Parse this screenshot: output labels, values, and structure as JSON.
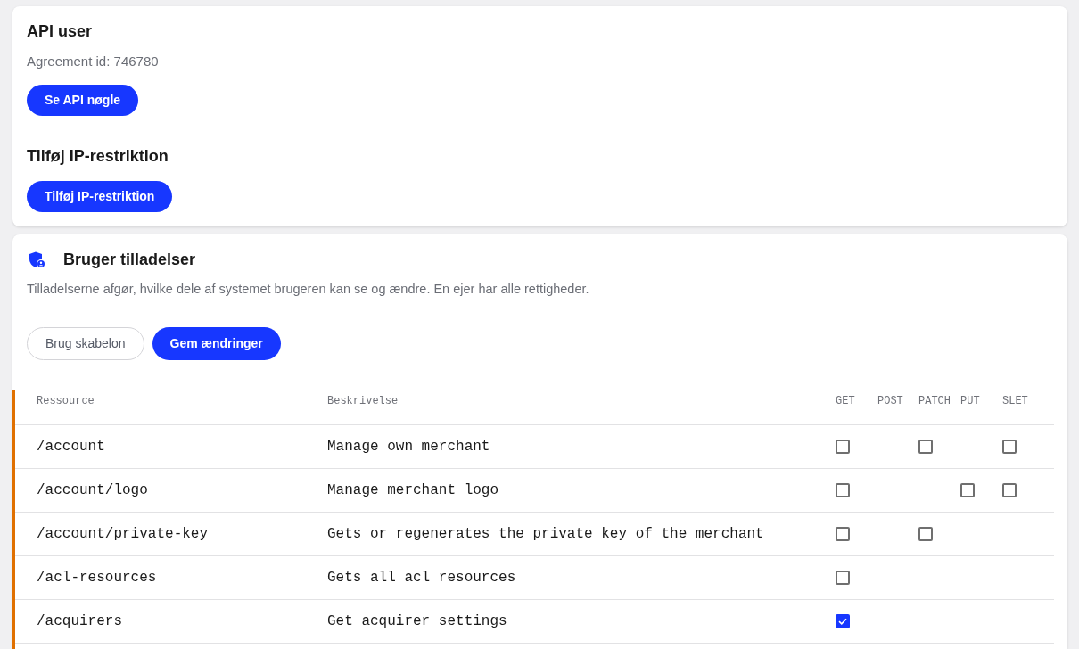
{
  "api_user": {
    "title": "API user",
    "agreement": "Agreement id: 746780",
    "button": "Se API nøgle"
  },
  "ip_restriction": {
    "title": "Tilføj IP-restriktion",
    "button": "Tilføj IP-restriktion"
  },
  "permissions": {
    "title": "Bruger tilladelser",
    "description": "Tilladelserne afgør, hvilke dele af systemet brugeren kan se og ændre. En ejer har alle rettigheder.",
    "buttons": [
      {
        "label": "Brug skabelon",
        "kind": "outline"
      },
      {
        "label": "Gem ændringer",
        "kind": "primary"
      }
    ],
    "table": {
      "columns": [
        "Ressource",
        "Beskrivelse",
        "GET",
        "POST",
        "PATCH",
        "PUT",
        "SLET"
      ],
      "rows": [
        {
          "resource": "/account",
          "description": "Manage own merchant",
          "methods": [
            {
              "kind": "checkbox",
              "checked": false
            },
            {
              "kind": "none"
            },
            {
              "kind": "checkbox",
              "checked": false
            },
            {
              "kind": "none"
            },
            {
              "kind": "checkbox",
              "checked": false
            }
          ]
        },
        {
          "resource": "/account/logo",
          "description": "Manage merchant logo",
          "methods": [
            {
              "kind": "checkbox",
              "checked": false
            },
            {
              "kind": "none"
            },
            {
              "kind": "none"
            },
            {
              "kind": "checkbox",
              "checked": false
            },
            {
              "kind": "checkbox",
              "checked": false
            }
          ]
        },
        {
          "resource": "/account/private-key",
          "description": "Gets or regenerates the private key of the merchant",
          "methods": [
            {
              "kind": "checkbox",
              "checked": false
            },
            {
              "kind": "none"
            },
            {
              "kind": "checkbox",
              "checked": false
            },
            {
              "kind": "none"
            },
            {
              "kind": "none"
            }
          ]
        },
        {
          "resource": "/acl-resources",
          "description": "Gets all acl resources",
          "methods": [
            {
              "kind": "checkbox",
              "checked": false
            },
            {
              "kind": "none"
            },
            {
              "kind": "none"
            },
            {
              "kind": "none"
            },
            {
              "kind": "none"
            }
          ]
        },
        {
          "resource": "/acquirers",
          "description": "Get acquirer settings",
          "methods": [
            {
              "kind": "checkbox",
              "checked": true
            },
            {
              "kind": "none"
            },
            {
              "kind": "none"
            },
            {
              "kind": "none"
            },
            {
              "kind": "none"
            }
          ]
        }
      ]
    }
  }
}
